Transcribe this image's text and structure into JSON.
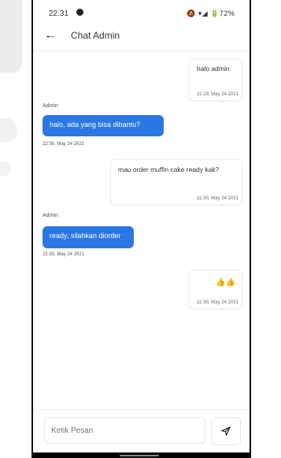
{
  "status": {
    "time": "22.31",
    "icons": "🔕 ▾◢ 🔋72%"
  },
  "header": {
    "title": "Chat Admin",
    "back_icon": "arrow-left-icon"
  },
  "messages": [
    {
      "side": "out",
      "text": "halo admin",
      "timestamp": "22:29, May 24 2021"
    },
    {
      "side": "in",
      "sender": "Admin",
      "text": "halo, ada yang bisa dibantu?",
      "timestamp": "22:30, May 24 2021"
    },
    {
      "side": "out",
      "text": "mau order muffin cake ready kak?",
      "timestamp": "22:30, May 24 2021"
    },
    {
      "side": "in",
      "sender": "Admin",
      "text": "ready, silahkan diorder",
      "timestamp": "22:30, May 24 2021"
    },
    {
      "side": "out",
      "text": "👍👍",
      "timestamp": "22:30, May 24 2021"
    }
  ],
  "composer": {
    "placeholder": "Ketik Pesan",
    "send_icon": "send-icon"
  },
  "colors": {
    "accent": "#2b78e4",
    "bubble_out_bg": "#ffffff",
    "text": "#333333"
  }
}
